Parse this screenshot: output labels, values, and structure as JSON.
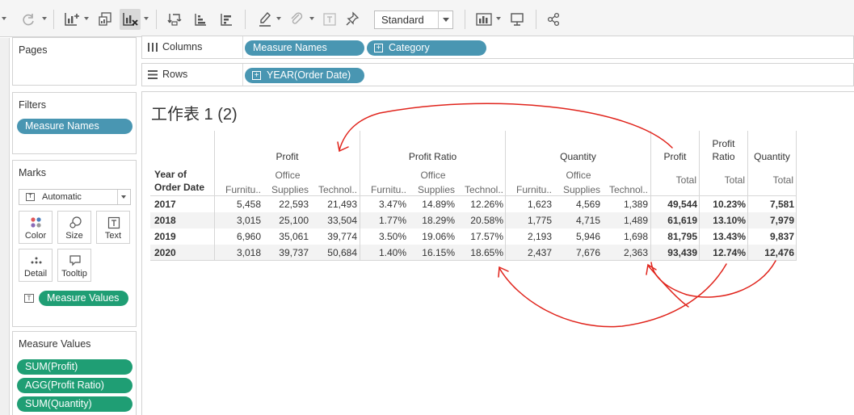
{
  "toolbar": {
    "icons": [
      "redo-icon",
      "new-worksheet-icon",
      "duplicate-sheet-icon",
      "clear-sheet-icon",
      "swap-icon",
      "sort-ascending-icon",
      "sort-descending-icon",
      "highlight-icon",
      "group-icon",
      "label-icon",
      "pin-icon",
      "show-me-icon",
      "presentation-icon",
      "share-icon"
    ],
    "view_mode": "Standard"
  },
  "panes": {
    "pages_title": "Pages",
    "filters_title": "Filters",
    "filters": [
      "Measure Names"
    ],
    "marks_title": "Marks",
    "mark_type": "Automatic",
    "mark_buttons": [
      "Color",
      "Size",
      "Text",
      "Detail",
      "Tooltip"
    ],
    "mark_field": "Measure Values",
    "measure_values_title": "Measure Values",
    "measure_values": [
      "SUM(Profit)",
      "AGG(Profit Ratio)",
      "SUM(Quantity)"
    ]
  },
  "shelves": {
    "columns_label": "Columns",
    "columns": [
      "Measure Names",
      "Category"
    ],
    "rows_label": "Rows",
    "rows": [
      "YEAR(Order Date)"
    ]
  },
  "sheet": {
    "title": "工作表 1 (2)",
    "row_header": [
      "Year of",
      "Order Date"
    ],
    "groups": [
      "Profit",
      "Profit Ratio",
      "Quantity"
    ],
    "sub_office": "Office",
    "sub_cols": [
      "Furnitu..",
      "Supplies",
      "Technol.."
    ],
    "total_headers": [
      [
        "Profit",
        ""
      ],
      [
        "Profit",
        "Ratio"
      ],
      [
        "Quantity",
        ""
      ]
    ],
    "total_label": "Total",
    "rows": [
      {
        "year": "2017",
        "profit": [
          "5,458",
          "22,593",
          "21,493"
        ],
        "ratio": [
          "3.47%",
          "14.89%",
          "12.26%"
        ],
        "qty": [
          "1,623",
          "4,569",
          "1,389"
        ],
        "totals": [
          "49,544",
          "10.23%",
          "7,581"
        ]
      },
      {
        "year": "2018",
        "profit": [
          "3,015",
          "25,100",
          "33,504"
        ],
        "ratio": [
          "1.77%",
          "18.29%",
          "20.58%"
        ],
        "qty": [
          "1,775",
          "4,715",
          "1,489"
        ],
        "totals": [
          "61,619",
          "13.10%",
          "7,979"
        ]
      },
      {
        "year": "2019",
        "profit": [
          "6,960",
          "35,061",
          "39,774"
        ],
        "ratio": [
          "3.50%",
          "19.06%",
          "17.57%"
        ],
        "qty": [
          "2,193",
          "5,946",
          "1,698"
        ],
        "totals": [
          "81,795",
          "13.43%",
          "9,837"
        ]
      },
      {
        "year": "2020",
        "profit": [
          "3,018",
          "39,737",
          "50,684"
        ],
        "ratio": [
          "1.40%",
          "16.15%",
          "18.65%"
        ],
        "qty": [
          "2,437",
          "7,676",
          "2,363"
        ],
        "totals": [
          "93,439",
          "12.74%",
          "12,476"
        ]
      }
    ]
  },
  "colors": {
    "blue_pill": "#4996b2",
    "green_pill": "#1f9e74",
    "annotation": "#e0231b"
  }
}
